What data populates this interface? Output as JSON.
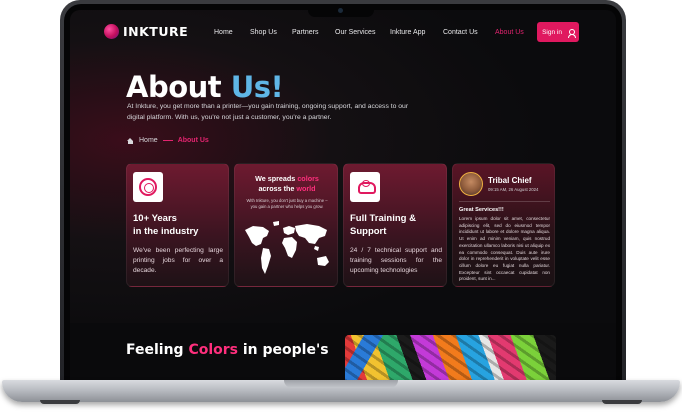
{
  "brand": {
    "name": "INKTURE"
  },
  "nav": {
    "items": [
      {
        "label": "Home"
      },
      {
        "label": "Shop Us"
      },
      {
        "label": "Partners"
      },
      {
        "label": "Our Services"
      },
      {
        "label": "Inkture App"
      },
      {
        "label": "Contact Us"
      },
      {
        "label": "About Us",
        "active": true
      }
    ],
    "signin_label": "Sign in"
  },
  "hero": {
    "title_main": "About ",
    "title_accent": "Us!",
    "description": "At Inkture, you get more than a printer—you gain training, ongoing support, and access to our digital platform. With us, you're not just a customer, you're a partner."
  },
  "breadcrumb": {
    "home": "Home",
    "current": "About Us"
  },
  "cards": {
    "experience": {
      "title_line1": "10+ Years",
      "title_line2": "in the industry",
      "text": "We've been perfecting large printing jobs for over a decade."
    },
    "world": {
      "title_part1": "We spreads ",
      "title_accent1": "colors",
      "title_part2": "across the ",
      "title_accent2": "world",
      "text": "With Inkture, you don't just buy a machine – you gain a partner who helps you grow."
    },
    "training": {
      "title_line1": "Full Training &",
      "title_line2": "Support",
      "text": "24 / 7 technical support and training sessions for the upcoming technologies"
    },
    "review": {
      "name": "Tribal Chief",
      "date": "09:15 AM, 26 August 2024",
      "heading": "Great Services!!!",
      "body": "Lorem ipsum dolor sit amet, consectetur adipiscing elit, sed do eiusmod tempor incididunt ut labore et dolore magna aliqua. Ut enim ad minim veniam, quis nostrud exercitation ullamco laboris nisi ut aliquip ex ea commodo consequat. Duis aute irure dolor in reprehenderit in voluptate velit esse cillum dolore eu fugiat nulla pariatur. Excepteur sint occaecat cupidatat non proident, sunt in..."
    }
  },
  "lower": {
    "title_part1": "Feeling ",
    "title_accent": "Colors",
    "title_part2": " in people's"
  },
  "colors": {
    "accent_pink": "#e0195f",
    "accent_blue": "#5fb6e6",
    "background": "#0b0b0d"
  },
  "icons": [
    "medal-icon",
    "world-map",
    "support-icon",
    "avatar",
    "user-icon",
    "home-icon"
  ]
}
